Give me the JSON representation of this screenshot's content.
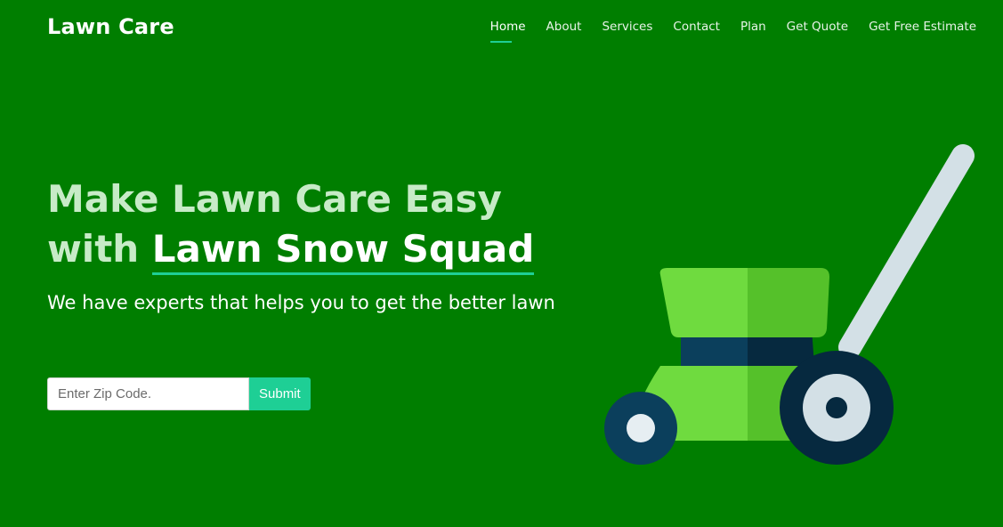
{
  "header": {
    "brand": "Lawn Care",
    "nav": [
      {
        "label": "Home",
        "active": true
      },
      {
        "label": "About",
        "active": false
      },
      {
        "label": "Services",
        "active": false
      },
      {
        "label": "Contact",
        "active": false
      },
      {
        "label": "Plan",
        "active": false
      },
      {
        "label": "Get Quote",
        "active": false
      },
      {
        "label": "Get Free Estimate",
        "active": false
      }
    ]
  },
  "hero": {
    "headline_part1": "Make Lawn Care Easy with ",
    "headline_highlight": "Lawn Snow Squad",
    "subtitle": "We have experts that helps you to get the better lawn",
    "zip_placeholder": "Enter Zip Code.",
    "zip_value": "",
    "submit_label": "Submit"
  },
  "illustration": {
    "icon": "lawn-mower-icon"
  },
  "colors": {
    "background": "#007e00",
    "accent": "#1ecf95",
    "headline": "#c7ebc7",
    "mower_light_green": "#6fdb3f",
    "mower_dark_green": "#55c12a",
    "mower_navy": "#0b3f5c",
    "mower_dark_navy": "#06293f",
    "mower_grey": "#d3e0e6"
  }
}
